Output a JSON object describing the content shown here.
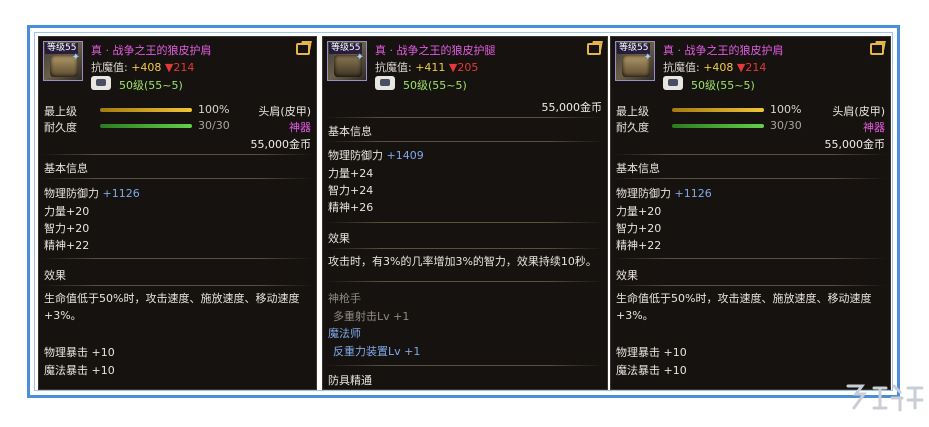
{
  "left": {
    "level_tag": "等级55",
    "name": "真 · 战争之王的狼皮护肩",
    "magic_resist_label": "抗魔值: ",
    "magic_resist_value": "+408",
    "magic_resist_diff": "▼214",
    "level_req": "50级(55~5)",
    "max_level_label": "最上级",
    "max_level_value": "100%",
    "slot": "头肩(皮甲)",
    "durability_label": "耐久度",
    "durability_value": "30/30",
    "rarity": "神器",
    "price": "55,000金币",
    "basic_info_title": "基本信息",
    "phys_def_label": "物理防御力 ",
    "phys_def_value": "+1126",
    "str": "力量+20",
    "int": "智力+20",
    "spirit": "精神+22",
    "effect_title": "效果",
    "effect_desc": "生命值低于50%时，攻击速度、施放速度、移动速度+3%。",
    "phys_crit": "物理暴击 +10",
    "magic_crit": "魔法暴击 +10"
  },
  "middle": {
    "level_tag": "等级55",
    "name": "真 · 战争之王的狼皮护腿",
    "magic_resist_label": "抗魔值: ",
    "magic_resist_value": "+411",
    "magic_resist_diff": "▼205",
    "level_req": "50级(55~5)",
    "price": "55,000金币",
    "basic_info_title": "基本信息",
    "phys_def_label": "物理防御力 ",
    "phys_def_value": "+1409",
    "str": "力量+24",
    "int": "智力+24",
    "spirit": "精神+26",
    "effect_title": "效果",
    "effect_desc": "攻击时，有3%的几率增加3%的智力，效果持续10秒。",
    "class1": "神枪手",
    "skill1": "多重射击Lv +1",
    "class2": "魔法师",
    "skill2": "反重力装置Lv +1",
    "mastery_title": "防具精通"
  },
  "right": {
    "level_tag": "等级55",
    "name": "真 · 战争之王的狼皮护肩",
    "magic_resist_label": "抗魔值: ",
    "magic_resist_value": "+408",
    "magic_resist_diff": "▼214",
    "level_req": "50级(55~5)",
    "max_level_label": "最上级",
    "max_level_value": "100%",
    "slot": "头肩(皮甲)",
    "durability_label": "耐久度",
    "durability_value": "30/30",
    "rarity": "神器",
    "price": "55,000金币",
    "basic_info_title": "基本信息",
    "phys_def_label": "物理防御力 ",
    "phys_def_value": "+1126",
    "str": "力量+20",
    "int": "智力+20",
    "spirit": "精神+22",
    "effect_title": "效果",
    "effect_desc": "生命值低于50%时，攻击速度、施放速度、移动速度+3%。",
    "phys_crit": "物理暴击 +10",
    "magic_crit": "魔法暴击 +10"
  },
  "colors": {
    "frame": "#4a8fd8",
    "item_name": "#e25be0",
    "level_req": "#9fe36a",
    "stat_bonus": "#7fa8e8",
    "resist_down": "#e23a3a"
  },
  "icons": [
    "item-icon",
    "external-link-icon",
    "gem-icon",
    "watermark-logo"
  ]
}
